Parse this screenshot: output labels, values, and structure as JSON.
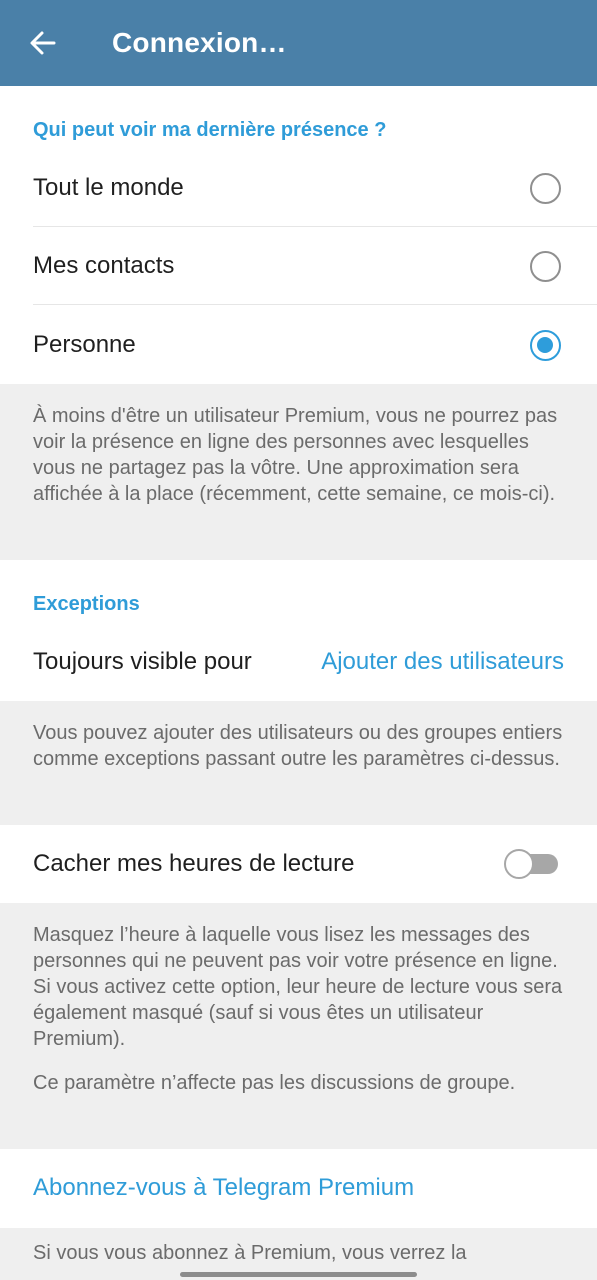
{
  "header": {
    "title": "Connexion…",
    "back_icon": "arrow-left-icon",
    "background": "#4a80a8"
  },
  "last_seen": {
    "header": "Qui peut voir ma dernière présence ?",
    "options": [
      {
        "label": "Tout le monde",
        "selected": false
      },
      {
        "label": "Mes contacts",
        "selected": false
      },
      {
        "label": "Personne",
        "selected": true
      }
    ],
    "info": "À moins d'être un utilisateur Premium, vous ne pourrez pas voir la présence en ligne des personnes avec lesquelles vous ne partagez pas la vôtre. Une approximation sera affichée à la place (récemment, cette semaine, ce mois-ci)."
  },
  "exceptions": {
    "header": "Exceptions",
    "always_visible_label": "Toujours visible pour",
    "always_visible_value": "Ajouter des utilisateurs",
    "info": "Vous pouvez ajouter des utilisateurs ou des groupes entiers comme exceptions passant outre les paramètres ci-dessus."
  },
  "read_time": {
    "label": "Cacher mes heures de lecture",
    "enabled": false,
    "info_1": "Masquez l’heure à laquelle vous lisez les messages des personnes qui ne peuvent pas voir votre présence en ligne. Si vous activez cette option, leur heure de lecture vous sera également masqué (sauf si vous êtes un utilisateur Premium).",
    "info_2": "Ce paramètre n’affecte pas les discussions de groupe."
  },
  "premium": {
    "link_label": "Abonnez-vous à Telegram Premium",
    "info": "Si vous vous abonnez à Premium, vous verrez la"
  },
  "colors": {
    "accent": "#2f9cd8",
    "radio_selected": "#2e9ddb",
    "gray_section": "#efefef"
  }
}
